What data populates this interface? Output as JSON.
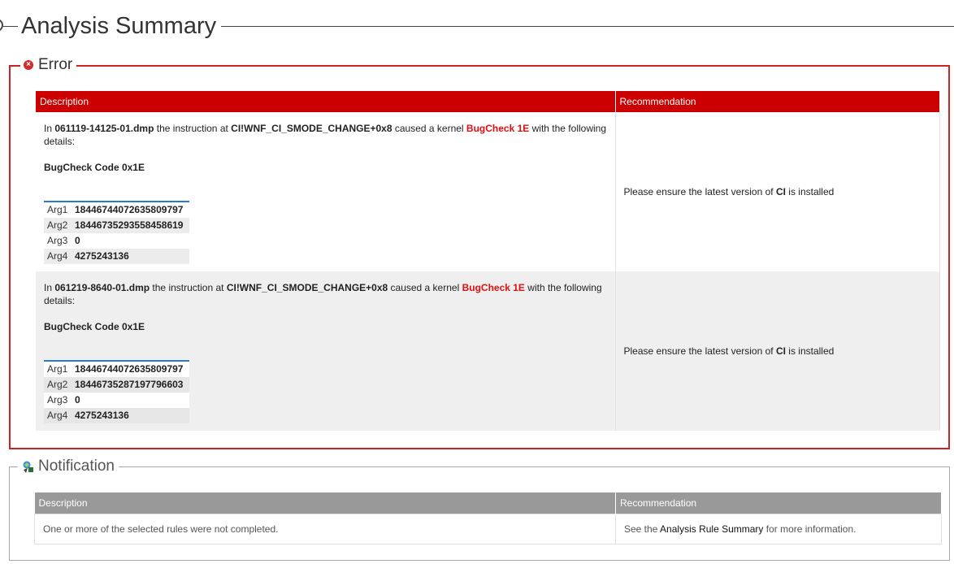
{
  "header": {
    "title": "Analysis Summary"
  },
  "error": {
    "legend": "Error",
    "columns": {
      "description": "Description",
      "recommendation": "Recommendation"
    },
    "rows": [
      {
        "prefix": "In ",
        "file": "061119-14125-01.dmp",
        "mid": " the instruction at ",
        "instruction": "CI!WNF_CI_SMODE_CHANGE+0x8",
        "mid2": " caused a kernel ",
        "bugcheck": "BugCheck 1E",
        "suffix": " with the following details:",
        "code": "BugCheck Code 0x1E",
        "args": [
          {
            "k": "Arg1",
            "v": "18446744072635809797"
          },
          {
            "k": "Arg2",
            "v": "18446735293558458619"
          },
          {
            "k": "Arg3",
            "v": "0"
          },
          {
            "k": "Arg4",
            "v": "4275243136"
          }
        ],
        "rec_prefix": "Please ensure the latest version of ",
        "rec_bold": "CI",
        "rec_suffix": " is installed"
      },
      {
        "prefix": "In ",
        "file": "061219-8640-01.dmp",
        "mid": " the instruction at ",
        "instruction": "CI!WNF_CI_SMODE_CHANGE+0x8",
        "mid2": " caused a kernel ",
        "bugcheck": "BugCheck 1E",
        "suffix": " with the following details:",
        "code": "BugCheck Code 0x1E",
        "args": [
          {
            "k": "Arg1",
            "v": "18446744072635809797"
          },
          {
            "k": "Arg2",
            "v": "18446735287197796603"
          },
          {
            "k": "Arg3",
            "v": "0"
          },
          {
            "k": "Arg4",
            "v": "4275243136"
          }
        ],
        "rec_prefix": "Please ensure the latest version of ",
        "rec_bold": "CI",
        "rec_suffix": " is installed"
      }
    ]
  },
  "notification": {
    "legend": "Notification",
    "columns": {
      "description": "Description",
      "recommendation": "Recommendation"
    },
    "row": {
      "description": "One or more of the selected rules were not completed.",
      "rec_prefix": "See the ",
      "rec_link": "Analysis Rule Summary",
      "rec_suffix": " for more information."
    }
  },
  "colors": {
    "error": "#cc0000",
    "notification_header": "#999999",
    "arg_table_accent": "#2a7bd4"
  }
}
